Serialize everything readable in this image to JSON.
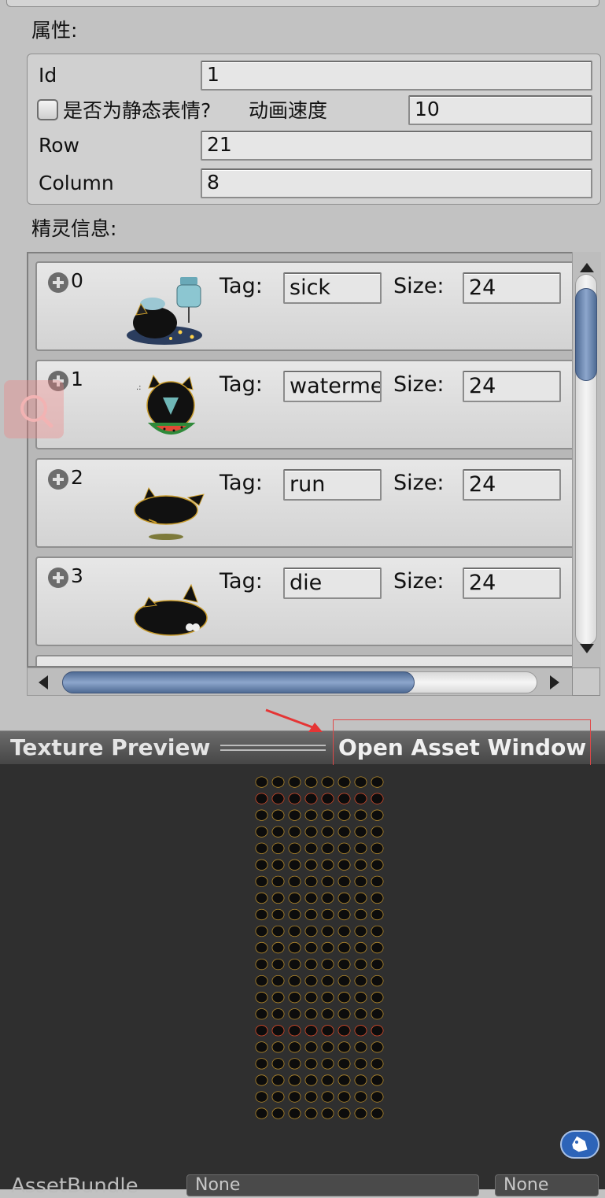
{
  "properties": {
    "section_label": "属性:",
    "id_label": "Id",
    "id_value": "1",
    "static_checkbox_label": "是否为静态表情?",
    "anim_speed_label": "动画速度",
    "anim_speed_value": "10",
    "row_label": "Row",
    "row_value": "21",
    "column_label": "Column",
    "column_value": "8"
  },
  "sprites": {
    "section_label": "精灵信息:",
    "tag_label": "Tag:",
    "size_label": "Size:",
    "items": [
      {
        "index": "0",
        "tag": "sick",
        "size": "24"
      },
      {
        "index": "1",
        "tag": "watermelon",
        "size": "24"
      },
      {
        "index": "2",
        "tag": "run",
        "size": "24"
      },
      {
        "index": "3",
        "tag": "die",
        "size": "24"
      }
    ]
  },
  "preview": {
    "title": "Texture Preview",
    "open_asset_label": "Open Asset Window"
  },
  "footer": {
    "assetbundle_label": "AssetBundle",
    "bundle_name_value": "None",
    "bundle_variant_value": "None"
  },
  "colors": {
    "annotation_red": "#e04848",
    "scroll_thumb": "#6b86ad",
    "tag_button": "#2d64b8"
  }
}
